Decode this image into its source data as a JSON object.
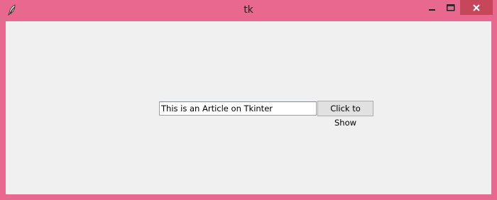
{
  "window": {
    "title": "tk",
    "frame_color": "#e8688f",
    "close_button_color": "#c7475a",
    "client_color": "#f0f0f0",
    "icon": "tk-feather-icon"
  },
  "controls": {
    "entry_value": "This is an Article on Tkinter",
    "button_label": "Click to Show"
  }
}
